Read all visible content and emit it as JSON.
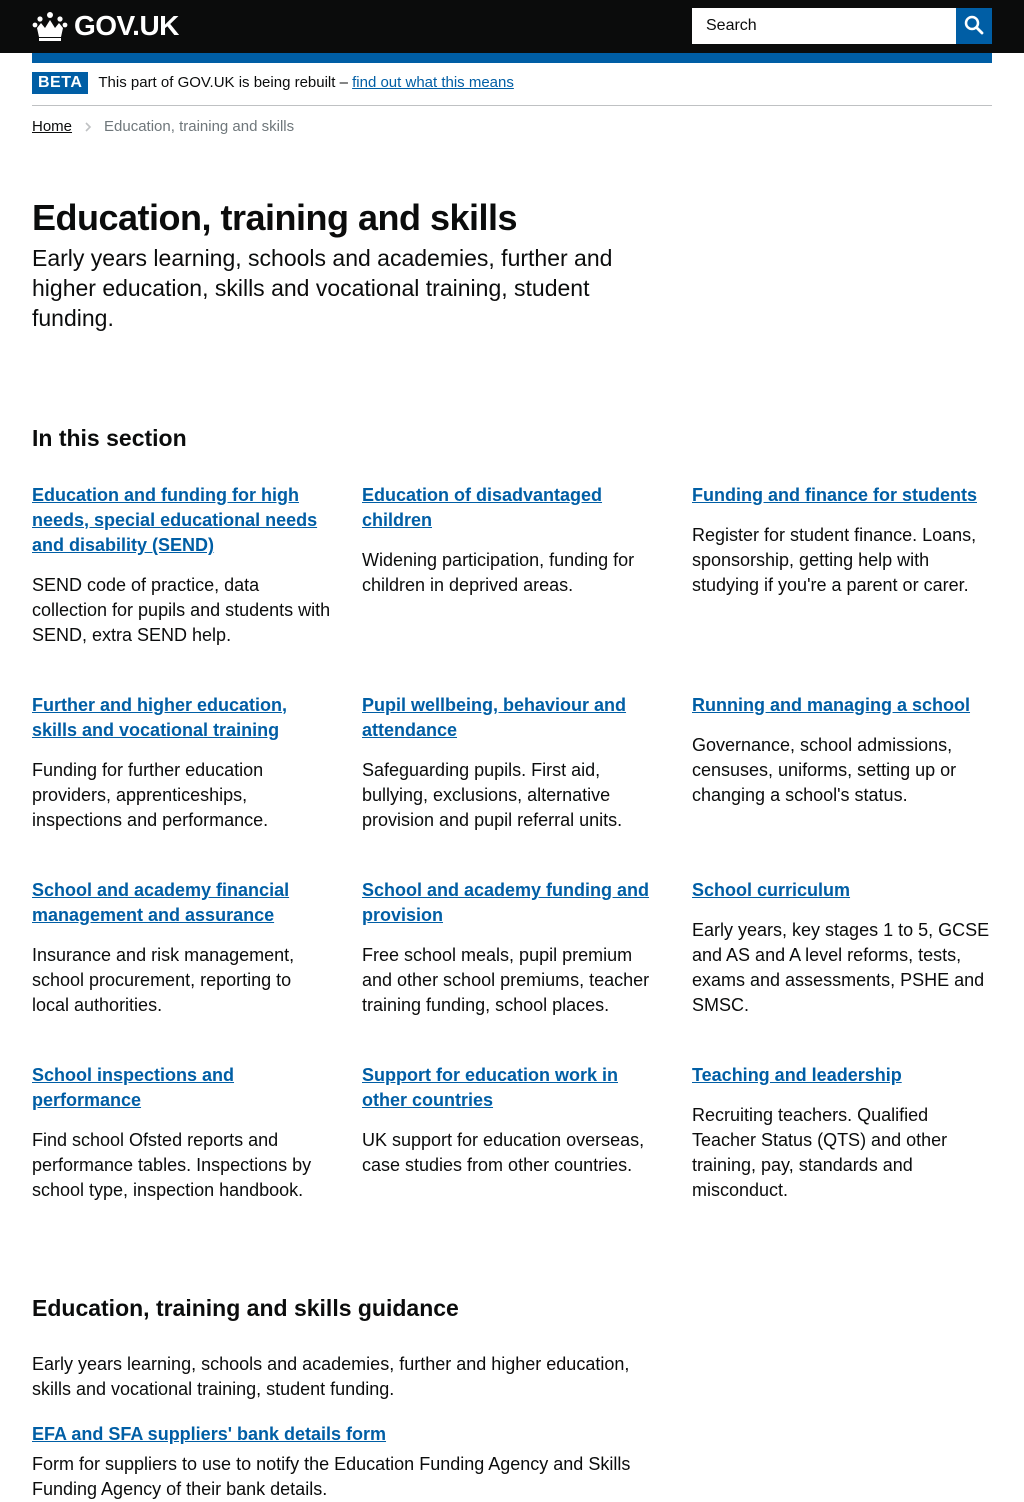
{
  "header": {
    "logo_text": "GOV.UK",
    "logo_icon": "crown-icon",
    "search_placeholder": "Search",
    "search_icon": "search-icon",
    "background_color": "#0b0c0c",
    "accent_color": "#005ea5"
  },
  "beta_banner": {
    "tag": "BETA",
    "text": "This part of GOV.UK is being rebuilt – ",
    "link_text": "find out what this means"
  },
  "breadcrumb": {
    "home": "Home",
    "separator_icon": "chevron-right-icon",
    "current": "Education, training and skills"
  },
  "page": {
    "title": "Education, training and skills",
    "lead": "Early years learning, schools and academies, further and higher education, skills and vocational training, student funding."
  },
  "section": {
    "heading": "In this section",
    "items": [
      {
        "title": "Education and funding for high needs, special educational needs and disability (SEND)",
        "description": "SEND code of practice, data collection for pupils and students with SEND, extra SEND help."
      },
      {
        "title": "Education of disadvantaged children",
        "description": "Widening participation, funding for children in deprived areas."
      },
      {
        "title": "Funding and finance for students",
        "description": "Register for student finance. Loans, sponsorship, getting help with studying if you're a parent or carer."
      },
      {
        "title": "Further and higher education, skills and vocational training",
        "description": "Funding for further education providers, apprenticeships, inspections and performance."
      },
      {
        "title": "Pupil wellbeing, behaviour and attendance",
        "description": "Safeguarding pupils. First aid, bullying, exclusions, alternative provision and pupil referral units."
      },
      {
        "title": "Running and managing a school",
        "description": "Governance, school admissions, censuses, uniforms, setting up or changing a school's status."
      },
      {
        "title": "School and academy financial management and assurance",
        "description": "Insurance and risk management, school procurement, reporting to local authorities."
      },
      {
        "title": "School and academy funding and provision",
        "description": "Free school meals, pupil premium and other school premiums, teacher training funding, school places."
      },
      {
        "title": "School curriculum",
        "description": "Early years, key stages 1 to 5, GCSE and AS and A level reforms, tests, exams and assessments, PSHE and SMSC."
      },
      {
        "title": "School inspections and performance",
        "description": "Find school Ofsted reports and performance tables. Inspections by school type, inspection handbook."
      },
      {
        "title": "Support for education work in other countries",
        "description": "UK support for education overseas, case studies from other countries."
      },
      {
        "title": "Teaching and leadership",
        "description": "Recruiting teachers. Qualified Teacher Status (QTS) and other training, pay, standards and misconduct."
      }
    ]
  },
  "guidance": {
    "heading": "Education, training and skills guidance",
    "lead": "Early years learning, schools and academies, further and higher education, skills and vocational training, student funding.",
    "link_text": "EFA and SFA suppliers' bank details form",
    "link_description": "Form for suppliers to use to notify the Education Funding Agency and Skills Funding Agency of their bank details."
  }
}
